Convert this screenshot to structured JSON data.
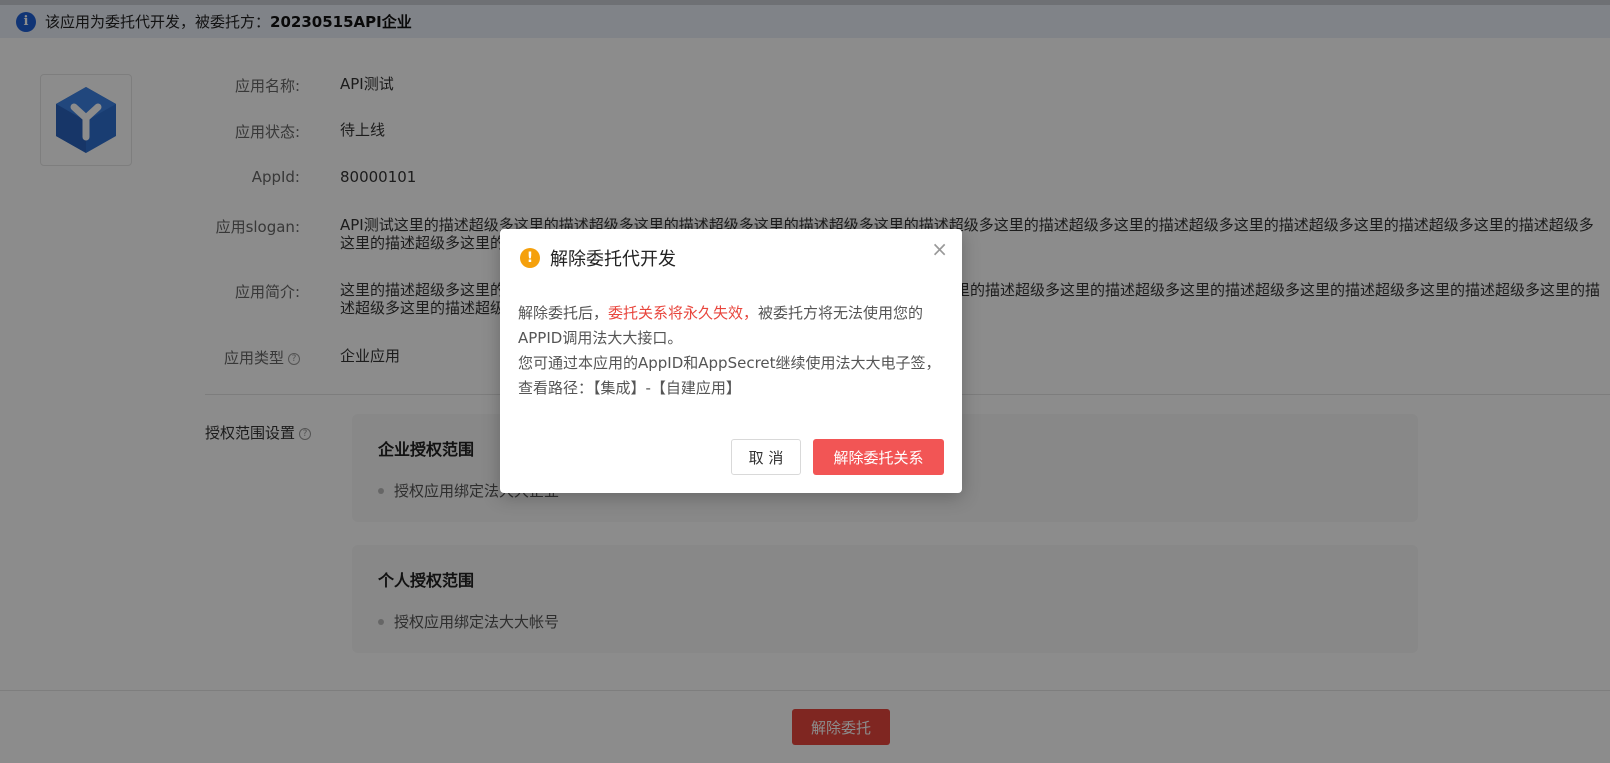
{
  "banner": {
    "icon": "info-icon",
    "text": "该应用为委托代开发，被委托方：",
    "entity": "20230515API企业"
  },
  "app": {
    "logo_icon": "cube-y-logo-icon",
    "fields": [
      {
        "label": "应用名称:",
        "value": "API测试"
      },
      {
        "label": "应用状态:",
        "value": "待上线"
      },
      {
        "label": "AppId:",
        "value": "80000101"
      },
      {
        "label": "应用slogan:",
        "value": "API测试这里的描述超级多这里的描述超级多这里的描述超级多这里的描述超级多这里的描述超级多这里的描述超级多这里的描述超级多这里的描述超级多这里的描述超级多这里的描述超级多这里的描述超级多这里的描述超级多这里的描述超级多这里的描述超级多"
      },
      {
        "label": "应用简介:",
        "value": "这里的描述超级多这里的描述超级多这里的描述超级多这里的描述超级多这里的描述超级多这里的描述超级多这里的描述超级多这里的描述超级多这里的描述超级多这里的描述超级多这里的描述超级多这里的描述超级多这里的描述超级多这里的描述超级多这里的描述超级多"
      },
      {
        "label": "应用类型",
        "value": "企业应用"
      }
    ]
  },
  "scope": {
    "label": "授权范围设置",
    "cards": [
      {
        "title": "企业授权范围",
        "item": "授权应用绑定法大大企业"
      },
      {
        "title": "个人授权范围",
        "item": "授权应用绑定法大大帐号"
      }
    ]
  },
  "footer": {
    "button": "解除委托"
  },
  "modal": {
    "title": "解除委托代开发",
    "body_prefix": "解除委托后，",
    "body_highlight": "委托关系将永久失效，",
    "body_rest": "被委托方将无法使用您的APPID调用法大大接口。",
    "body_second": "您可通过本应用的AppID和AppSecret继续使用法大大电子签，查看路径：【集成】-【自建应用】",
    "cancel": "取 消",
    "confirm": "解除委托关系",
    "colors": {
      "highlight": "#e8453c",
      "confirm": "#f25555",
      "warn": "#f5a00c"
    }
  }
}
